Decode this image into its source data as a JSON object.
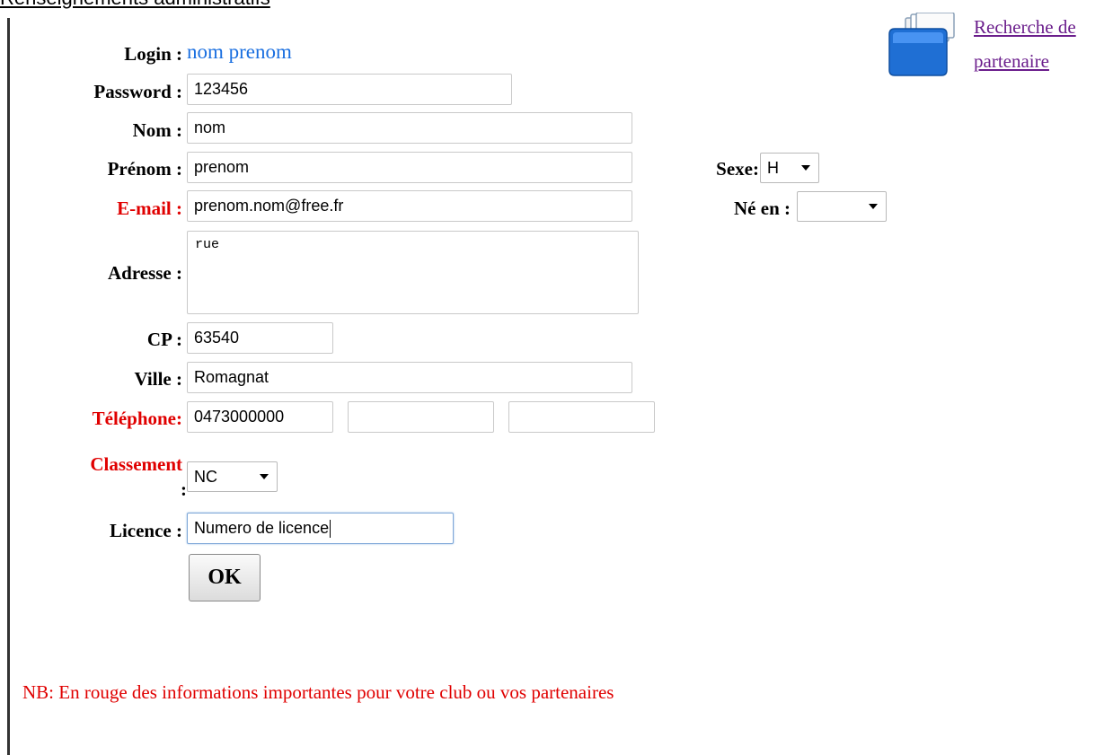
{
  "header": {
    "section_title": "Renseignements administratifs"
  },
  "partner_link": {
    "label_line1": "Recherche de",
    "label_line2": "partenaire",
    "icon": "folder-icon"
  },
  "form": {
    "login": {
      "label": "Login :",
      "value": "nom prenom"
    },
    "password": {
      "label": "Password :",
      "value": "123456"
    },
    "nom": {
      "label": "Nom :",
      "value": "nom"
    },
    "prenom": {
      "label": "Prénom :",
      "value": "prenom"
    },
    "sexe": {
      "label": "Sexe:",
      "selected": "H"
    },
    "email": {
      "label": "E-mail :",
      "value": "prenom.nom@free.fr"
    },
    "ne_en": {
      "label": "Né en :",
      "selected": ""
    },
    "adresse": {
      "label": "Adresse :",
      "value": "rue"
    },
    "cp": {
      "label": "CP :",
      "value": "63540"
    },
    "ville": {
      "label": "Ville :",
      "value": "Romagnat"
    },
    "telephone": {
      "label": "Téléphone:",
      "values": [
        "0473000000",
        "",
        ""
      ]
    },
    "classement": {
      "label_line1": "Classement",
      "label_line2": ":",
      "selected": "NC"
    },
    "licence": {
      "label": "Licence :",
      "value": "Numero de licence"
    },
    "submit_label": "OK"
  },
  "footer": {
    "note": "NB: En rouge des informations importantes pour votre club ou vos partenaires"
  },
  "colors": {
    "important": "#e00000",
    "login_value": "#1a6fe0",
    "link": "#6b1e8c"
  }
}
